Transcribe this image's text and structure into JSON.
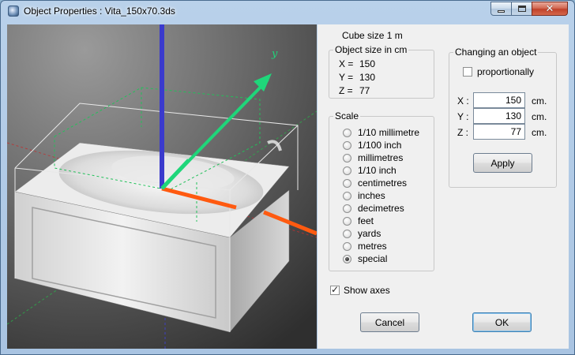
{
  "window": {
    "title": "Object Properties : Vita_150x70.3ds"
  },
  "titlebar": {
    "close_glyph": "✕"
  },
  "cube_size": "Cube size 1 m",
  "object_size": {
    "title": "Object size in cm",
    "x_label": "X =",
    "x_value": "150",
    "y_label": "Y =",
    "y_value": "130",
    "z_label": "Z =",
    "z_value": "77"
  },
  "scale": {
    "title": "Scale",
    "options": [
      "1/10 millimetre",
      "1/100 inch",
      "millimetres",
      "1/10 inch",
      "centimetres",
      "inches",
      "decimetres",
      "feet",
      "yards",
      "metres",
      "special"
    ],
    "selected": "special"
  },
  "changing": {
    "title": "Changing an object",
    "proportionally_label": "proportionally",
    "proportionally_checked": false,
    "x_label": "X :",
    "x_value": "150",
    "y_label": "Y :",
    "y_value": "130",
    "z_label": "Z :",
    "z_value": "77",
    "unit": "cm.",
    "apply_label": "Apply"
  },
  "show_axes": {
    "label": "Show axes",
    "checked": true
  },
  "buttons": {
    "cancel_label": "Cancel",
    "ok_label": "OK"
  },
  "viewport": {
    "axis_label_y": "y"
  },
  "colors": {
    "x_axis": "#ff5a10",
    "y_axis": "#1fd67a",
    "z_axis": "#3a3acd"
  }
}
